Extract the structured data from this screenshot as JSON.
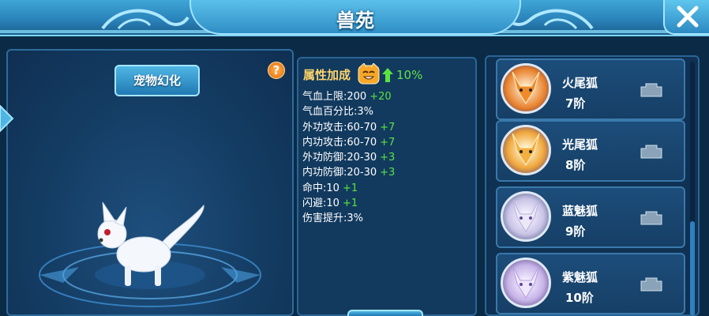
{
  "header": {
    "title": "兽苑"
  },
  "left": {
    "morph_button": "宠物幻化",
    "help_label": "?"
  },
  "attributes": {
    "header_label": "属性加成",
    "bonus": "10%",
    "rows": [
      {
        "label": "气血上限:200",
        "plus": "+20"
      },
      {
        "label": "气血百分比:3%",
        "plus": ""
      },
      {
        "label": "外功攻击:60-70",
        "plus": "+7"
      },
      {
        "label": "内功攻击:60-70",
        "plus": "+7"
      },
      {
        "label": "外功防御:20-30",
        "plus": "+3"
      },
      {
        "label": "内功防御:20-30",
        "plus": "+3"
      },
      {
        "label": "命中:10",
        "plus": "+1"
      },
      {
        "label": "闪避:10",
        "plus": "+1"
      },
      {
        "label": "伤害提升:3%",
        "plus": ""
      }
    ]
  },
  "pets": [
    {
      "name": "火尾狐",
      "level": "7阶",
      "color": "#e8822e"
    },
    {
      "name": "光尾狐",
      "level": "8阶",
      "color": "#f0a83c"
    },
    {
      "name": "蓝魅狐",
      "level": "9阶",
      "color": "#c9c3e6"
    },
    {
      "name": "紫魅狐",
      "level": "10阶",
      "color": "#c7b4e8"
    }
  ],
  "colors": {
    "accent": "#5be23e",
    "gold": "#ffd56a"
  }
}
